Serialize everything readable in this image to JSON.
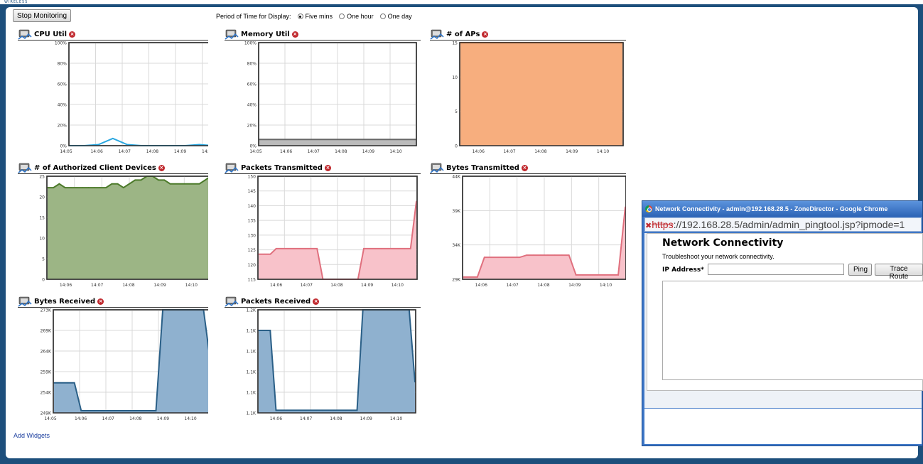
{
  "brand": {
    "logo_text": "WIRELESS"
  },
  "toolbar": {
    "stop_label": "Stop Monitoring",
    "period_label": "Period of Time for Display:",
    "options": [
      {
        "label": "Five mins",
        "selected": true
      },
      {
        "label": "One hour",
        "selected": false
      },
      {
        "label": "One day",
        "selected": false
      }
    ]
  },
  "widgets": [
    {
      "title": "CPU Util",
      "icon": "cpu-icon",
      "color": "#2aa7e0",
      "fill": "#2aa7e0",
      "fill_opacity": 0.0,
      "y_ticks": [
        "100%",
        "80%",
        "60%",
        "40%",
        "20%",
        "0%"
      ],
      "ylim": [
        0,
        100
      ],
      "x_ticks": [
        "14:05",
        "14:06",
        "14:07",
        "14:08",
        "14:09",
        "14:10"
      ],
      "x_first_outside": true,
      "chart_data": {
        "type": "line",
        "x": [
          "14:05",
          "14:05:15",
          "14:05:30",
          "14:05:45",
          "14:06",
          "14:06:30",
          "14:07",
          "14:08",
          "14:09",
          "14:09:30",
          "14:10",
          "14:10:30"
        ],
        "values": [
          0,
          0,
          1,
          7,
          1,
          0,
          0,
          0,
          0,
          1,
          0,
          0
        ]
      }
    },
    {
      "title": "Memory Util",
      "icon": "memory-icon",
      "color": "#666666",
      "fill": "#bbbbbb",
      "fill_opacity": 1.0,
      "y_ticks": [
        "100%",
        "80%",
        "60%",
        "40%",
        "20%",
        "0%"
      ],
      "ylim": [
        0,
        100
      ],
      "x_ticks": [
        "14:05",
        "14:06",
        "14:07",
        "14:08",
        "14:09",
        "14:10"
      ],
      "x_first_outside": true,
      "chart_data": {
        "type": "area",
        "x": [
          "14:05",
          "14:10:30"
        ],
        "values": [
          6,
          6
        ]
      }
    },
    {
      "title": "# of APs",
      "icon": "ap-icon",
      "color": "#c76a2c",
      "fill": "#f7ae7e",
      "fill_opacity": 1.0,
      "y_ticks": [
        "15",
        "10",
        "5",
        "0"
      ],
      "ylim": [
        0,
        15
      ],
      "x_ticks": [
        "14:06",
        "14:07",
        "14:08",
        "14:09",
        "14:10"
      ],
      "x_first_outside": false,
      "chart_data": {
        "type": "area",
        "x": [
          "14:05",
          "14:10:30"
        ],
        "values": [
          15,
          15
        ]
      }
    },
    {
      "title": "# of Authorized Client Devices",
      "icon": "clients-icon",
      "color": "#4c7a2a",
      "fill": "#9cb585",
      "fill_opacity": 1.0,
      "y_ticks": [
        "25",
        "20",
        "15",
        "10",
        "5",
        "0"
      ],
      "ylim": [
        0,
        27
      ],
      "x_ticks": [
        "14:06",
        "14:07",
        "14:08",
        "14:09",
        "14:10"
      ],
      "x_first_outside": false,
      "chart_data": {
        "type": "area",
        "values": [
          24,
          24,
          25,
          24,
          24,
          24,
          24,
          24,
          24,
          24,
          24,
          25,
          25,
          24,
          25,
          26,
          26,
          27,
          27,
          26,
          26,
          25,
          25,
          25,
          25,
          25,
          25,
          26,
          27
        ]
      }
    },
    {
      "title": "Packets Transmitted",
      "icon": "packets-tx-icon",
      "color": "#e0707e",
      "fill": "#f8c2ca",
      "fill_opacity": 1.0,
      "y_ticks": [
        "150",
        "145",
        "140",
        "135",
        "130",
        "125",
        "120",
        "115"
      ],
      "ylim": [
        114,
        151
      ],
      "x_ticks": [
        "14:06",
        "14:07",
        "14:08",
        "14:09",
        "14:10"
      ],
      "x_first_outside": false,
      "chart_data": {
        "type": "area",
        "values": [
          123,
          123,
          123,
          125,
          125,
          125,
          125,
          125,
          125,
          125,
          125,
          114,
          114,
          114,
          114,
          114,
          114,
          114,
          125,
          125,
          125,
          125,
          125,
          125,
          125,
          125,
          125,
          142
        ]
      }
    },
    {
      "title": "Bytes Transmitted",
      "icon": "bytes-tx-icon",
      "color": "#e0707e",
      "fill": "#f8c2ca",
      "fill_opacity": 1.0,
      "y_ticks": [
        "44K",
        "39K",
        "34K",
        "29K"
      ],
      "ylim": [
        24500,
        48000
      ],
      "x_ticks": [
        "14:06",
        "14:07",
        "14:08",
        "14:09",
        "14:10"
      ],
      "x_first_outside": false,
      "chart_data": {
        "type": "area",
        "values": [
          25000,
          25000,
          25000,
          29500,
          29500,
          29500,
          29500,
          29500,
          29500,
          30000,
          30000,
          30000,
          30000,
          30000,
          30000,
          30000,
          25500,
          25500,
          25500,
          25500,
          25500,
          25500,
          25500,
          41000
        ]
      }
    },
    {
      "title": "Bytes Received",
      "icon": "bytes-rx-icon",
      "color": "#2a5f87",
      "fill": "#8fb1cf",
      "fill_opacity": 1.0,
      "y_ticks": [
        "273K",
        "269K",
        "264K",
        "259K",
        "254K",
        "249K"
      ],
      "ylim": [
        249000,
        273000
      ],
      "x_ticks": [
        "14:05",
        "14:06",
        "14:07",
        "14:08",
        "14:09",
        "14:10"
      ],
      "x_first_outside": true,
      "chart_data": {
        "type": "area",
        "values": [
          256000,
          256000,
          256000,
          256000,
          249500,
          249500,
          249500,
          249500,
          249500,
          249500,
          249500,
          249500,
          249500,
          249500,
          249500,
          249500,
          273000,
          273000,
          273000,
          273000,
          273000,
          273000,
          273000,
          261000
        ]
      }
    },
    {
      "title": "Packets Received",
      "icon": "packets-rx-icon",
      "color": "#2a5f87",
      "fill": "#8fb1cf",
      "fill_opacity": 1.0,
      "y_ticks": [
        "1.2K",
        "1.1K",
        "1.1K",
        "1.1K",
        "1.1K",
        "1.1K"
      ],
      "ylim": [
        1000,
        1200
      ],
      "x_ticks": [
        "14:06",
        "14:07",
        "14:08",
        "14:09",
        "14:10"
      ],
      "x_first_outside": false,
      "chart_data": {
        "type": "area",
        "values": [
          1160,
          1160,
          1160,
          1005,
          1005,
          1005,
          1005,
          1005,
          1005,
          1005,
          1005,
          1005,
          1005,
          1005,
          1005,
          1005,
          1005,
          1005,
          1200,
          1200,
          1200,
          1200,
          1200,
          1200,
          1200,
          1200,
          1200,
          1060
        ]
      }
    }
  ],
  "add_widgets": "Add Widgets",
  "popup": {
    "window_title": "Network Connectivity - admin@192.168.28.5 - ZoneDirector - Google Chrome",
    "url_scheme": "https",
    "url_rest": "://192.168.28.5/admin/admin_pingtool.jsp?ipmode=1",
    "heading": "Network Connectivity",
    "description": "Troubleshoot your network connectivity.",
    "ip_label": "IP Address*",
    "ip_value": "",
    "ping_label": "Ping",
    "trace_label": "Trace Route"
  }
}
